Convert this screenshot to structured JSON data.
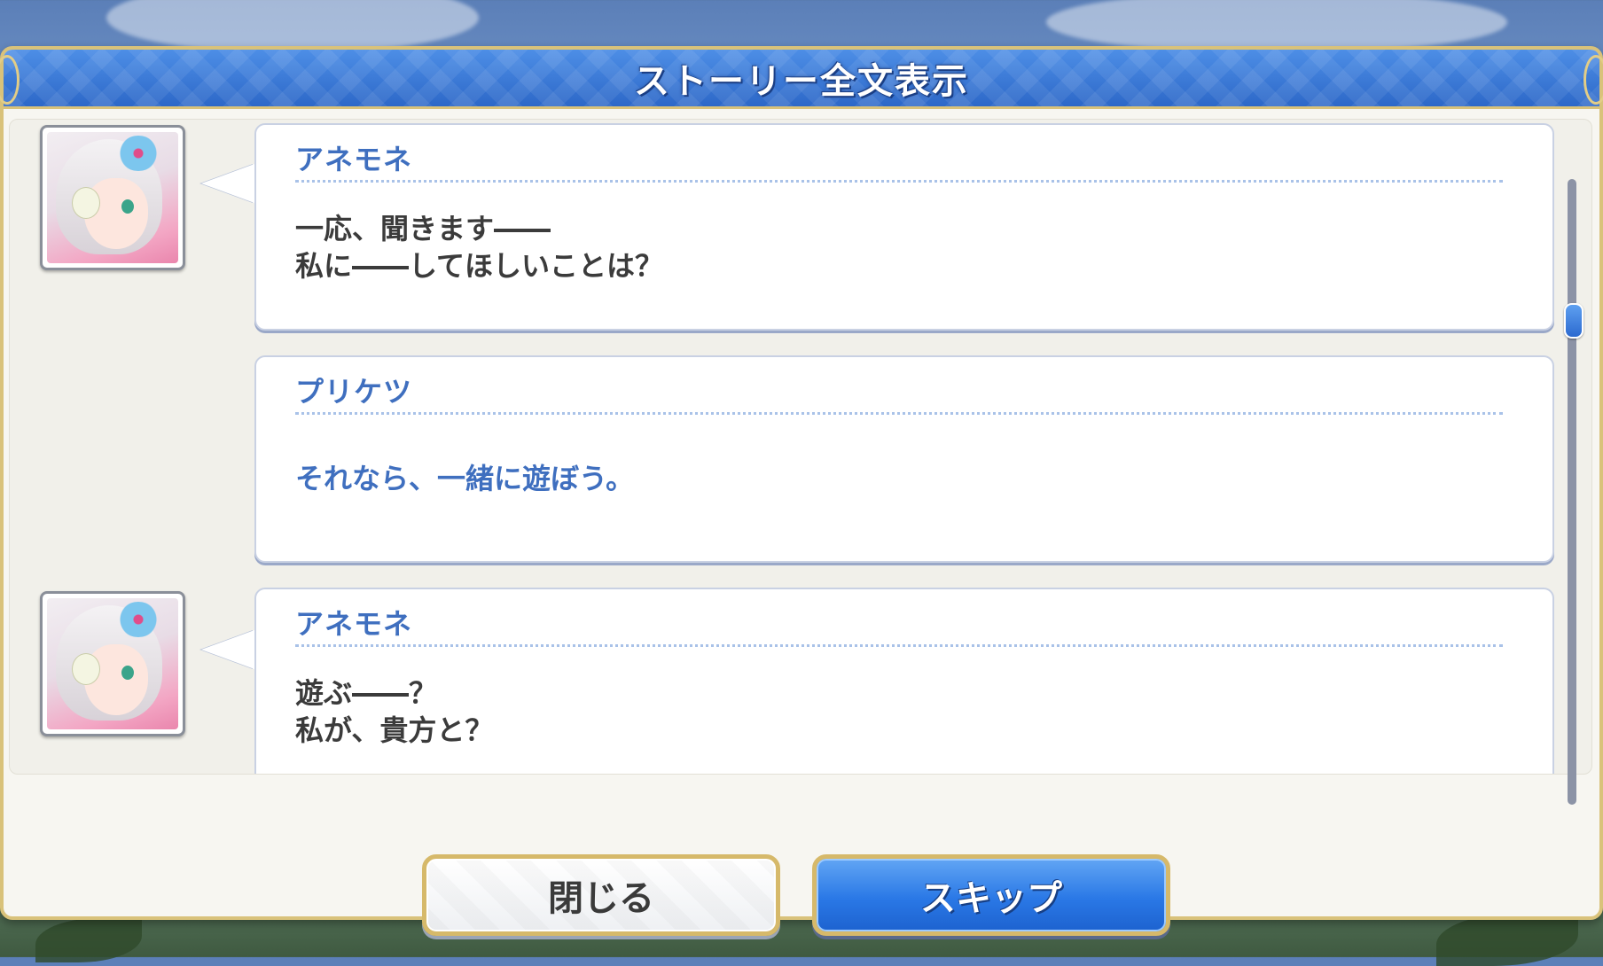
{
  "dialog": {
    "title": "ストーリー全文表示"
  },
  "entries": [
    {
      "speaker": "アネモネ",
      "lines": [
        "一応、聞きます――",
        "私に――してほしいことは？"
      ],
      "has_avatar": true
    },
    {
      "speaker": "プリケツ",
      "lines": [
        "それなら、一緒に遊ぼう。"
      ],
      "has_avatar": false
    },
    {
      "speaker": "アネモネ",
      "lines": [
        "遊ぶ――？",
        "私が、貴方と？"
      ],
      "has_avatar": true
    }
  ],
  "buttons": {
    "close_label": "閉じる",
    "skip_label": "スキップ"
  },
  "colors": {
    "accent_blue": "#3f6fbf",
    "frame_gold": "#d9c27a",
    "skip_button": "#2a78e6"
  },
  "icons": {
    "avatar": "anemone-portrait"
  }
}
